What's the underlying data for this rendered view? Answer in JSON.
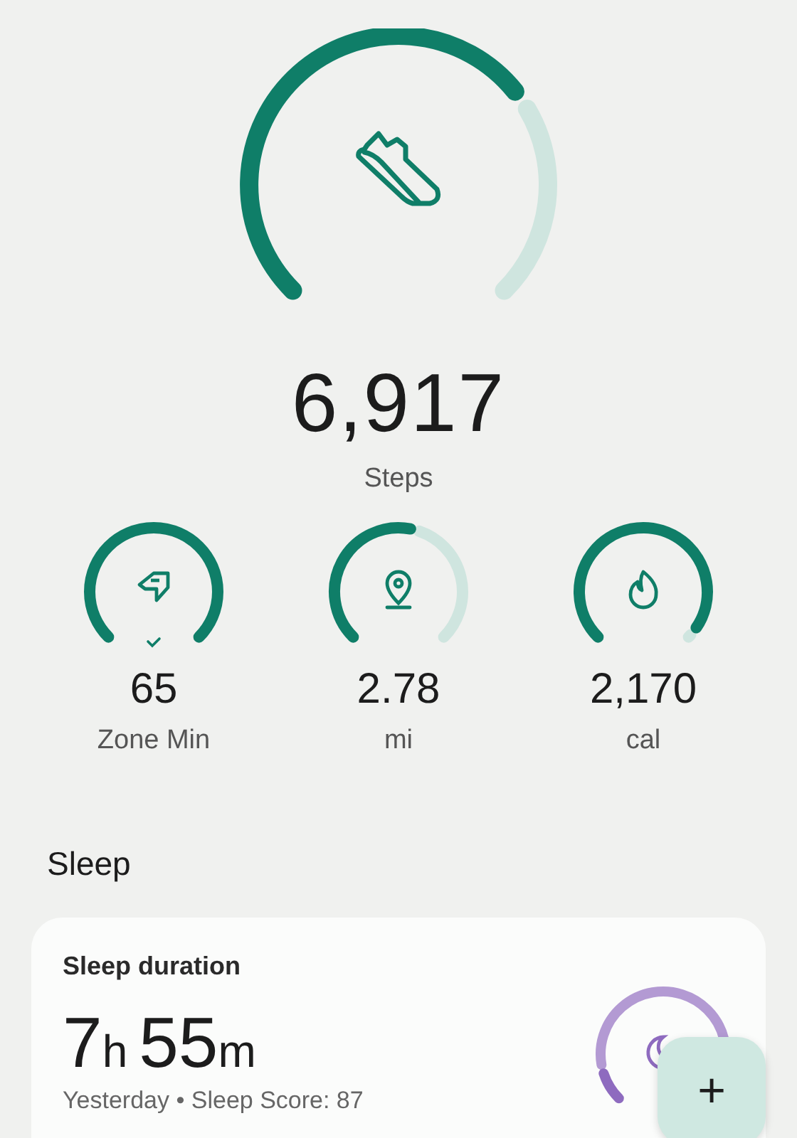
{
  "steps": {
    "value": "6,917",
    "label": "Steps"
  },
  "stats": [
    {
      "kind": "zone",
      "value": "65",
      "label": "Zone Min",
      "goal_met": true
    },
    {
      "kind": "distance",
      "value": "2.78",
      "label": "mi",
      "goal_met": false
    },
    {
      "kind": "calories",
      "value": "2,170",
      "label": "cal",
      "goal_met": false
    }
  ],
  "sleep": {
    "section_title": "Sleep",
    "card_title": "Sleep duration",
    "hours": "7",
    "hours_unit": "h",
    "minutes": "55",
    "minutes_unit": "m",
    "subtitle": "Yesterday • Sleep Score: 87"
  },
  "fab": {
    "label": "+"
  }
}
